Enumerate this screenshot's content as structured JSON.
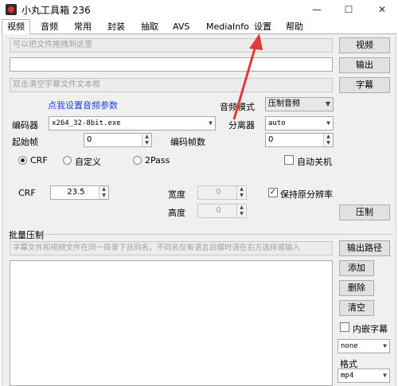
{
  "window": {
    "title": "小丸工具箱 236",
    "minimize": "—",
    "maximize": "☐",
    "close": "✕"
  },
  "tabs": [
    "视频",
    "音频",
    "常用",
    "封装",
    "抽取",
    "AVS",
    "MediaInfo",
    "设置",
    "帮助"
  ],
  "video_tab": {
    "video_input_placeholder": "可以把文件拖拽到这里",
    "output_value": "",
    "subtitle_placeholder": "双击清空字幕文件文本框",
    "video_button": "视频",
    "output_button": "输出",
    "subtitle_button": "字幕",
    "audio_params_link": "点我设置音频参数",
    "audio_mode_label": "音频模式",
    "audio_mode_value": "压制音频",
    "encoder_label": "编码器",
    "encoder_value": "x264_32-8bit.exe",
    "separator_label": "分离器",
    "separator_value": "auto",
    "start_frame_label": "起始帧",
    "start_frame_value": "0",
    "encode_frames_label": "编码帧数",
    "encode_frames_value": "0",
    "mode_crf": "CRF",
    "mode_custom": "自定义",
    "mode_2pass": "2Pass",
    "auto_shutdown": "自动关机",
    "crf_label": "CRF",
    "crf_value": "23.5",
    "width_label": "宽度",
    "width_value": "0",
    "height_label": "高度",
    "height_value": "0",
    "keep_resolution": "保持原分辨率",
    "encode_button": "压制"
  },
  "batch": {
    "title": "批量压制",
    "hint": "字幕文件和视频文件在同一目录下且同名，不同名仅有语言后缀时请在右方选择或输入",
    "output_path_button": "输出路径",
    "add_button": "添加",
    "delete_button": "删除",
    "clear_button": "清空",
    "embed_subs": "内嵌字幕",
    "subtitle_lang_value": "none",
    "format_label": "格式",
    "format_value": "mp4"
  },
  "colors": {
    "link": "#1f3fe0",
    "arrow": "#e03a3a"
  }
}
